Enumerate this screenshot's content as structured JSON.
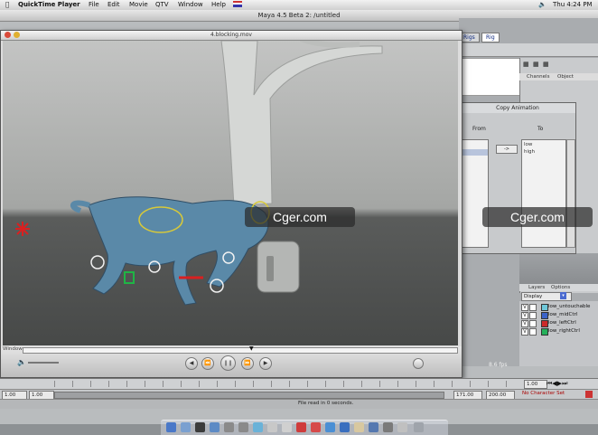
{
  "menubar": {
    "app_name": "QuickTime Player",
    "items": [
      "File",
      "Edit",
      "Movie",
      "QTV",
      "Window",
      "Help"
    ],
    "clock": "Thu 4:24 PM"
  },
  "maya": {
    "title": "Maya 4.5 Beta 2: /untitled",
    "tabs": [
      "Rigs",
      "Rig"
    ],
    "channel_box": {
      "tabs": [
        "Channels",
        "Object"
      ]
    },
    "layers": {
      "tabs": [
        "Layers",
        "Options"
      ],
      "mode": "Display",
      "rows": [
        {
          "v": "V",
          "name": "low_untouchable",
          "color": "#6ec7d9"
        },
        {
          "v": "V",
          "name": "low_midCtrl",
          "color": "#3b63c8"
        },
        {
          "v": "V",
          "name": "low_leftCtrl",
          "color": "#cc2a2a"
        },
        {
          "v": "V",
          "name": "low_rightCtrl",
          "color": "#25b05a"
        }
      ]
    },
    "copy_animation": {
      "title": "Copy Animation",
      "from_label": "From",
      "to_label": "To",
      "to_items": [
        "low",
        "high"
      ],
      "arrow": "->"
    },
    "timeline": {
      "start": "1.00",
      "current": "1.00",
      "range_start": "1.00",
      "range_end": "171.00",
      "end": "200.00",
      "character": "No Character Set"
    },
    "status": "File read in 0 seconds."
  },
  "quicktime": {
    "title": "4.blocking.mov",
    "label": "Window",
    "fps": "8.6 fps"
  },
  "watermarks": [
    "Cger.com",
    "Cger.com"
  ],
  "colors": {
    "maya_bg": "#b9bcbe",
    "creature": "#5a89a8",
    "accent_red": "#d92020",
    "accent_green": "#1fb545"
  }
}
